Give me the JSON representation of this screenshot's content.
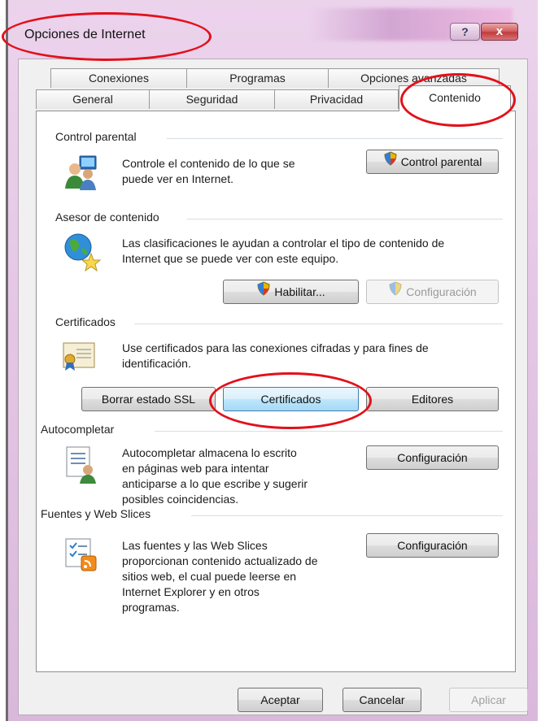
{
  "window": {
    "title": "Opciones de Internet",
    "help_glyph": "?",
    "close_glyph": "x"
  },
  "tabs": {
    "row1": [
      "Conexiones",
      "Programas",
      "Opciones avanzadas"
    ],
    "row2": [
      "General",
      "Seguridad",
      "Privacidad",
      "Contenido"
    ],
    "active": "Contenido"
  },
  "control_parental": {
    "header": "Control parental",
    "description_line1": "Controle el contenido de lo que se",
    "description_line2": "puede ver en Internet.",
    "button": "Control parental"
  },
  "asesor": {
    "header": "Asesor de contenido",
    "description_line1": "Las clasificaciones le ayudan a controlar el tipo de contenido de",
    "description_line2": "Internet que se puede ver con este equipo.",
    "habilitar_button": "Habilitar...",
    "configuracion_button": "Configuración"
  },
  "certificados": {
    "header": "Certificados",
    "description_line1": "Use certificados para las conexiones cifradas y para fines de",
    "description_line2": "identificación.",
    "ssl_button": "Borrar estado SSL",
    "certificados_button": "Certificados",
    "editores_button": "Editores"
  },
  "autocompletar": {
    "header": "Autocompletar",
    "lines": [
      "Autocompletar almacena lo escrito",
      "en páginas web para intentar",
      "anticiparse a lo que escribe y sugerir",
      "posibles coincidencias."
    ],
    "button": "Configuración"
  },
  "fuentes": {
    "header": "Fuentes y Web Slices",
    "lines": [
      "Las fuentes y las Web Slices",
      "proporcionan contenido actualizado de",
      "sitios web, el cual puede leerse en",
      "Internet Explorer y en otros",
      "programas."
    ],
    "button": "Configuración"
  },
  "footer": {
    "aceptar": "Aceptar",
    "cancelar": "Cancelar",
    "aplicar": "Aplicar"
  },
  "colors": {
    "highlight": "#e3101a",
    "window_chrome": "#e2c2e2"
  }
}
